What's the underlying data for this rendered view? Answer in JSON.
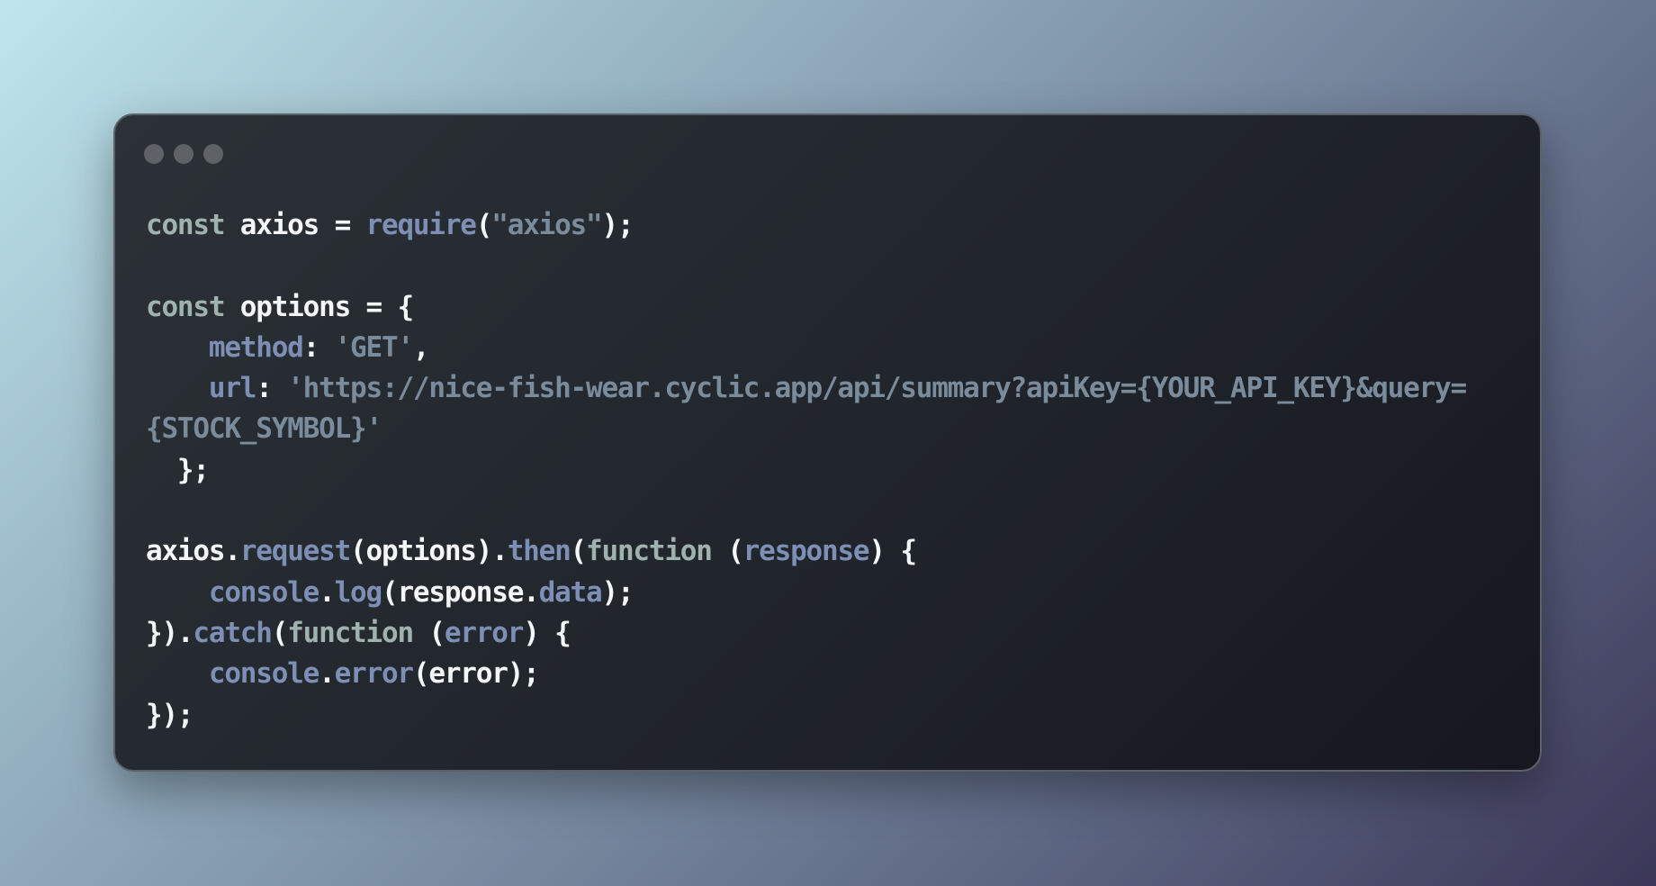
{
  "window": {
    "controls": [
      "close-dot",
      "minimize-dot",
      "maximize-dot"
    ]
  },
  "code": {
    "lines": [
      [
        {
          "t": "const",
          "c": "kw"
        },
        {
          "t": " axios ",
          "c": "plain"
        },
        {
          "t": "=",
          "c": "plain"
        },
        {
          "t": " ",
          "c": "plain"
        },
        {
          "t": "require",
          "c": "fn"
        },
        {
          "t": "(",
          "c": "plain"
        },
        {
          "t": "\"axios\"",
          "c": "str"
        },
        {
          "t": ");",
          "c": "plain"
        }
      ],
      [],
      [
        {
          "t": "const",
          "c": "kw"
        },
        {
          "t": " options ",
          "c": "plain"
        },
        {
          "t": "= {",
          "c": "plain"
        }
      ],
      [
        {
          "t": "    ",
          "c": "plain"
        },
        {
          "t": "method",
          "c": "prop"
        },
        {
          "t": ": ",
          "c": "plain"
        },
        {
          "t": "'GET'",
          "c": "str"
        },
        {
          "t": ",",
          "c": "plain"
        }
      ],
      [
        {
          "t": "    ",
          "c": "plain"
        },
        {
          "t": "url",
          "c": "prop"
        },
        {
          "t": ": ",
          "c": "plain"
        },
        {
          "t": "'https://nice-fish-wear.cyclic.app/api/summary?apiKey={YOUR_API_KEY}&query=",
          "c": "str"
        }
      ],
      [
        {
          "t": "{STOCK_SYMBOL}'",
          "c": "str"
        }
      ],
      [
        {
          "t": "  };",
          "c": "plain"
        }
      ],
      [],
      [
        {
          "t": "axios.",
          "c": "plain"
        },
        {
          "t": "request",
          "c": "fn"
        },
        {
          "t": "(options).",
          "c": "plain"
        },
        {
          "t": "then",
          "c": "fn"
        },
        {
          "t": "(",
          "c": "plain"
        },
        {
          "t": "function",
          "c": "kw"
        },
        {
          "t": " (",
          "c": "plain"
        },
        {
          "t": "response",
          "c": "prop"
        },
        {
          "t": ") {",
          "c": "plain"
        }
      ],
      [
        {
          "t": "    ",
          "c": "plain"
        },
        {
          "t": "console",
          "c": "prop"
        },
        {
          "t": ".",
          "c": "plain"
        },
        {
          "t": "log",
          "c": "fn"
        },
        {
          "t": "(response.",
          "c": "plain"
        },
        {
          "t": "data",
          "c": "prop"
        },
        {
          "t": ");",
          "c": "plain"
        }
      ],
      [
        {
          "t": "}).",
          "c": "plain"
        },
        {
          "t": "catch",
          "c": "fn"
        },
        {
          "t": "(",
          "c": "plain"
        },
        {
          "t": "function",
          "c": "kw"
        },
        {
          "t": " (",
          "c": "plain"
        },
        {
          "t": "error",
          "c": "prop"
        },
        {
          "t": ") {",
          "c": "plain"
        }
      ],
      [
        {
          "t": "    ",
          "c": "plain"
        },
        {
          "t": "console",
          "c": "prop"
        },
        {
          "t": ".",
          "c": "plain"
        },
        {
          "t": "error",
          "c": "fn"
        },
        {
          "t": "(error);",
          "c": "plain"
        }
      ],
      [
        {
          "t": "});",
          "c": "plain"
        }
      ]
    ]
  }
}
